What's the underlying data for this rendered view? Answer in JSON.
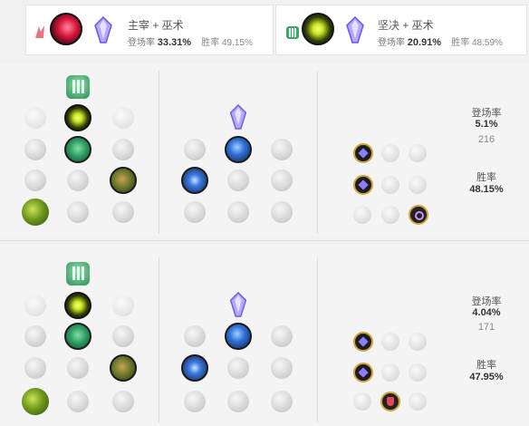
{
  "colors": {
    "accent": "#333333",
    "muted": "#888888",
    "sorcery": "#8d7cff",
    "resolve": "#2f9f63",
    "domination": "#d9163c"
  },
  "top_cards": [
    {
      "label": "主宰 + 巫术",
      "pick_label": "登场率",
      "pick_value": "33.31%",
      "win_label": "胜率",
      "win_value": "49.15%",
      "keystone_icon": "electrocute-icon",
      "secondary_icon": "sorcery-crystal-icon"
    },
    {
      "label": "坚决 + 巫术",
      "pick_label": "登场率",
      "pick_value": "20.91%",
      "win_label": "胜率",
      "win_value": "48.59%",
      "keystone_icon": "aftershock-icon",
      "secondary_icon": "sorcery-crystal-icon"
    }
  ],
  "builds": [
    {
      "pick_label": "登场率",
      "pick_value": "5.1%",
      "games": "216",
      "win_label": "胜率",
      "win_value": "48.15%"
    },
    {
      "pick_label": "登场率",
      "pick_value": "4.04%",
      "games": "171",
      "win_label": "胜率",
      "win_value": "47.95%"
    }
  ]
}
